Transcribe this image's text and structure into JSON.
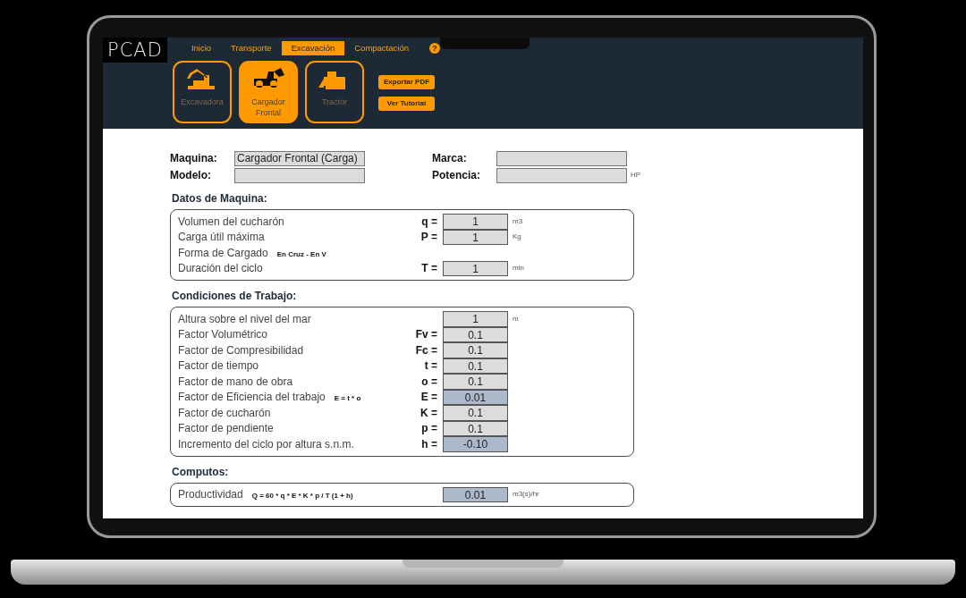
{
  "app": {
    "logo": "PCAD"
  },
  "tabs": [
    {
      "label": "Inicio",
      "kind": "tab",
      "selected": false
    },
    {
      "label": "Transporte",
      "kind": "tab",
      "selected": false
    },
    {
      "label": "Excavación",
      "kind": "tab",
      "selected": true
    },
    {
      "label": "Compactación",
      "kind": "tab",
      "selected": false
    },
    {
      "label": "?",
      "kind": "help"
    }
  ],
  "machines": [
    {
      "label": "Excavadora",
      "kind": "excavator",
      "selected": false
    },
    {
      "label": "Cargador Frontal",
      "kind": "loader",
      "selected": true
    },
    {
      "label": "Tractor",
      "kind": "dozer",
      "selected": false
    }
  ],
  "actions": [
    "Exportar PDF",
    "Ver Tutorial"
  ],
  "header_fields": [
    {
      "label": "Maquina:",
      "value": "Cargador Frontal (Carga)"
    },
    {
      "label": "Marca:"
    },
    {
      "label": "Modelo:"
    },
    {
      "label": "Potencia:",
      "unit": "HP"
    }
  ],
  "sections": [
    {
      "title": "Datos de Maquina:",
      "rows": [
        {
          "label": "Volumen del cucharón",
          "symbol": "q =",
          "value": "1",
          "unit": "m3",
          "kind": "input"
        },
        {
          "label": "Carga útil máxima",
          "symbol": "P =",
          "value": "1",
          "unit": "Kg",
          "kind": "input"
        },
        {
          "label": "Forma de Cargado",
          "note": "En Cruz  -  En V",
          "kind": "text"
        },
        {
          "label": "Duración del ciclo",
          "symbol": "T =",
          "value": "1",
          "unit": "min",
          "kind": "input"
        }
      ]
    },
    {
      "title": "Condiciones de Trabajo:",
      "rows": [
        {
          "label": "Altura sobre el nivel del mar",
          "value": "1",
          "unit": "m",
          "kind": "input"
        },
        {
          "label": "Factor Volumétrico",
          "symbol": "Fv =",
          "value": "0.1",
          "kind": "input"
        },
        {
          "label": "Factor de Compresibilidad",
          "symbol": "Fc =",
          "value": "0.1",
          "kind": "input"
        },
        {
          "label": "Factor de tiempo",
          "symbol": "t =",
          "value": "0.1",
          "kind": "input"
        },
        {
          "label": "Factor de mano de obra",
          "symbol": "o =",
          "value": "0.1",
          "kind": "input"
        },
        {
          "label": "Factor de Eficiencia del trabajo",
          "note": "E = t * o",
          "symbol": "E =",
          "value": "0.01",
          "kind": "computed"
        },
        {
          "label": "Factor de cucharón",
          "symbol": "K =",
          "value": "0.1",
          "kind": "input"
        },
        {
          "label": "Factor de pendiente",
          "symbol": "p =",
          "value": "0.1",
          "kind": "input"
        },
        {
          "label": "Incremento del ciclo por altura s.n.m.",
          "symbol": "h =",
          "value": "-0.10",
          "kind": "computed"
        }
      ]
    },
    {
      "title": "Computos:",
      "rows": [
        {
          "label": "Productividad",
          "note": "Q = 60 * q * E * K * p / T (1 + h)",
          "value": "0.01",
          "unit": "m3(s)/hr",
          "kind": "computed"
        }
      ]
    }
  ]
}
